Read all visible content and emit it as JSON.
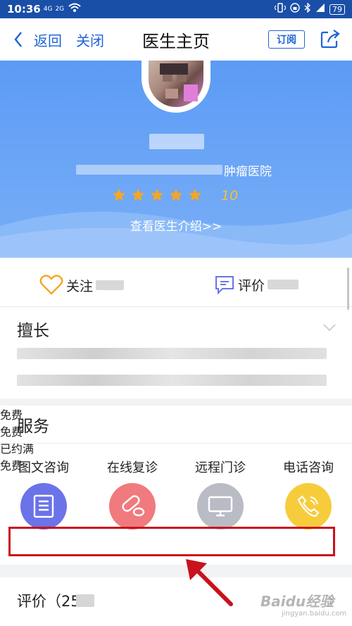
{
  "status_bar": {
    "time": "10:36",
    "network_1": "4G",
    "network_2": "2G",
    "battery": "79"
  },
  "nav": {
    "back_label": "返回",
    "close_label": "关闭",
    "title": "医生主页",
    "subscribe_label": "订阅"
  },
  "profile": {
    "hospital_suffix": "肿瘤医院",
    "rating": 5,
    "score": "10",
    "intro_link": "查看医生介绍>>"
  },
  "actions": {
    "follow_label": "关注",
    "review_label": "评价"
  },
  "expertise": {
    "heading": "擅长"
  },
  "services": {
    "heading": "服务",
    "items": [
      {
        "label": "图文咨询",
        "price": "免费",
        "color": "#6b73e8",
        "icon": "document-icon"
      },
      {
        "label": "在线复诊",
        "price": "免费",
        "color": "#f07a7d",
        "icon": "pill-icon"
      },
      {
        "label": "远程门诊",
        "price": "已约满",
        "color": "#b9bcc4",
        "icon": "monitor-icon"
      },
      {
        "label": "电话咨询",
        "price": "免费",
        "color": "#f7cc3c",
        "icon": "phone-icon"
      }
    ]
  },
  "reviews": {
    "heading": "评价（25"
  },
  "watermark": {
    "brand": "Baidu经验",
    "url": "jingyan.baidu.com"
  }
}
